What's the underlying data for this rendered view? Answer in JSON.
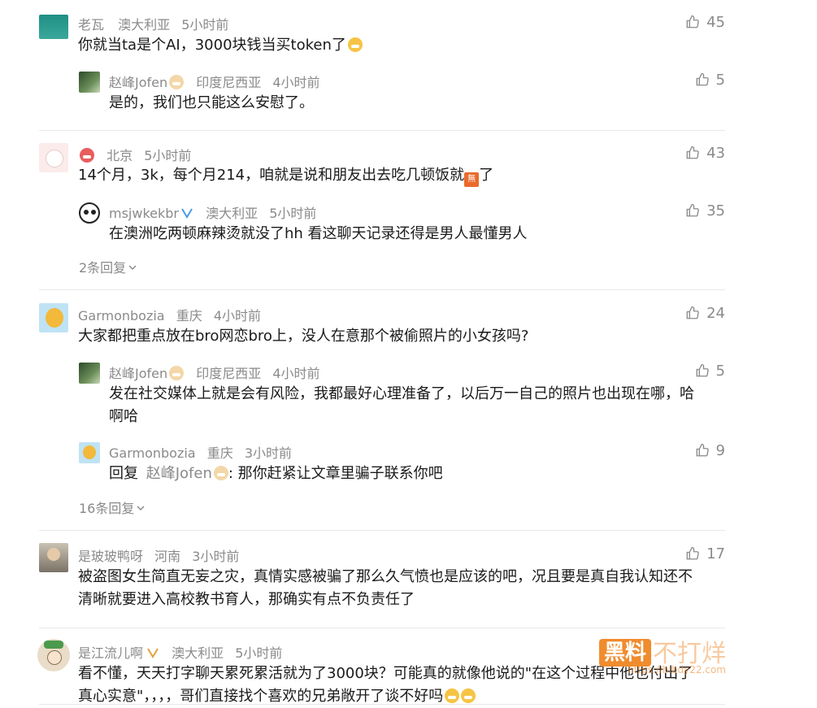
{
  "comments": [
    {
      "user": "老瓦",
      "location": "澳大利亚",
      "time": "5小时前",
      "likes": "45",
      "text": "你就当ta是个AI，3000块钱当买token了",
      "replies": [
        {
          "user": "赵峰Jofen",
          "location": "印度尼西亚",
          "time": "4小时前",
          "likes": "5",
          "text": "是的，我们也只能这么安慰了。"
        }
      ]
    },
    {
      "user": "北京",
      "time": "5小时前",
      "likes": "43",
      "text": "14个月，3k，每个月214，咱就是说和朋友出去吃几顿饭就",
      "text_tail": "了",
      "chip": "無",
      "replies": [
        {
          "user": "msjwkekbr",
          "location": "澳大利亚",
          "time": "5小时前",
          "likes": "35",
          "text": "在澳洲吃两顿麻辣烫就没了hh 看这聊天记录还得是男人最懂男人"
        }
      ],
      "more_replies": "2条回复"
    },
    {
      "user": "Garmonbozia",
      "location": "重庆",
      "time": "4小时前",
      "likes": "24",
      "text": "大家都把重点放在bro网恋bro上，没人在意那个被偷照片的小女孩吗?",
      "replies": [
        {
          "user": "赵峰Jofen",
          "location": "印度尼西亚",
          "time": "4小时前",
          "likes": "5",
          "text_line1": "发在社交媒体上就是会有风险，我都最好心理准备了，以后万一自己的照片也出现在哪，哈",
          "text_line2": "啊哈"
        },
        {
          "user": "Garmonbozia",
          "location": "重庆",
          "time": "3小时前",
          "likes": "9",
          "reply_prefix": "回复",
          "reply_to": "赵峰Jofen",
          "text": ": 那你赶紧让文章里骗子联系你吧"
        }
      ],
      "more_replies": "16条回复"
    },
    {
      "user": "是玻玻鸭呀",
      "location": "河南",
      "time": "3小时前",
      "likes": "17",
      "text_line1": "被盗图女生简直无妄之灾，真情实感被骗了那么久气愤也是应该的吧，况且要是真自我认知还不",
      "text_line2": "清晰就要进入高校教书育人，那确实有点不负责任了"
    },
    {
      "user": "是江流儿啊",
      "location": "澳大利亚",
      "time": "5小时前",
      "text_line1": "看不懂，天天打字聊天累死累活就为了3000块？可能真的就像他说的\"在这个过程中他也付出了",
      "text_line2": "真心实意\"，，，，哥们直接找个喜欢的兄弟敞开了谈不好吗"
    }
  ],
  "watermark": {
    "badge": "黑料",
    "text": "不打烊",
    "url": "https://hlbdy22.com"
  },
  "colors": {
    "meta": "#8a8a8a",
    "text": "#1a1a1a",
    "accent": "#f08c2e"
  },
  "icons": {
    "like": "thumbs-up-icon",
    "chevron": "chevron-down-icon",
    "verified": "verified-badge-icon"
  }
}
